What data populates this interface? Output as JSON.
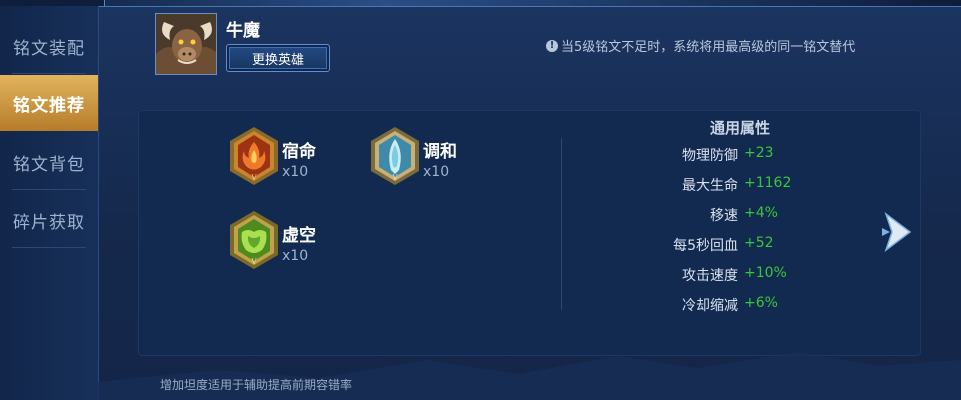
{
  "sidebar": {
    "items": [
      {
        "label": "铭文装配"
      },
      {
        "label": "铭文推荐"
      },
      {
        "label": "铭文背包"
      },
      {
        "label": "碎片获取"
      }
    ],
    "active_index": 1
  },
  "hero": {
    "name": "牛魔",
    "change_button": "更换英雄"
  },
  "notice": {
    "text": "当5级铭文不足时，系统将用最高级的同一铭文替代",
    "icon": "info-icon"
  },
  "runes": [
    {
      "name": "宿命",
      "count": "x10",
      "color": "#d0552a",
      "icon": "red-rune-icon"
    },
    {
      "name": "调和",
      "count": "x10",
      "color": "#7ec7d8",
      "icon": "blue-rune-icon"
    },
    {
      "name": "虚空",
      "count": "x10",
      "color": "#7fbf3a",
      "icon": "green-rune-icon"
    }
  ],
  "attributes": {
    "title": "通用属性",
    "rows": [
      {
        "name": "物理防御",
        "value": "+23"
      },
      {
        "name": "最大生命",
        "value": "+1162"
      },
      {
        "name": "移速",
        "value": "+4%"
      },
      {
        "name": "每5秒回血",
        "value": "+52"
      },
      {
        "name": "攻击速度",
        "value": "+10%"
      },
      {
        "name": "冷却缩减",
        "value": "+6%"
      }
    ]
  },
  "tip": "增加坦度适用于辅助提高前期容错率",
  "colors": {
    "accent_gold": "#d9a64e",
    "value_green": "#37c73a",
    "background": "#1b3561"
  }
}
